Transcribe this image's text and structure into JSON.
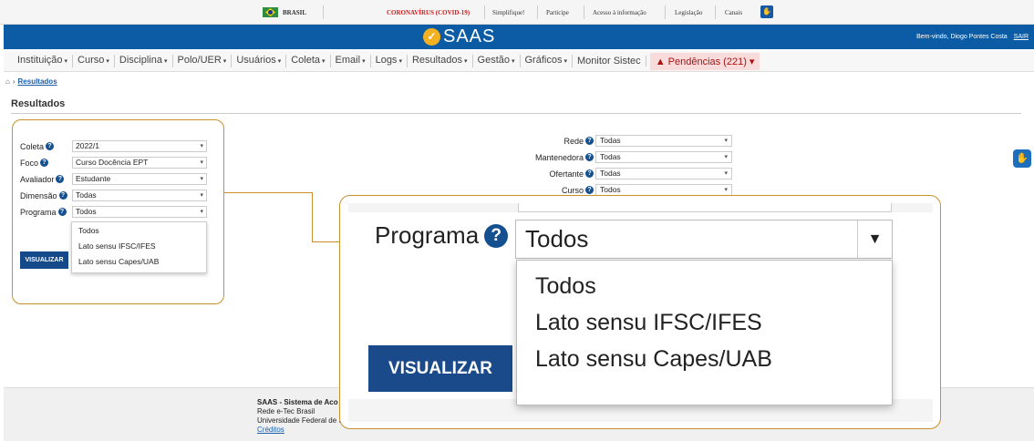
{
  "gov_bar": {
    "country": "BRASIL",
    "links": [
      "CORONAVÍRUS (COVID-19)",
      "Simplifique!",
      "Participe",
      "Acesso à informação",
      "Legislação",
      "Canais"
    ]
  },
  "header": {
    "app_name": "SAAS",
    "welcome": "Bem-vindo, Diogo Pontes Costa",
    "logout": "SAIR"
  },
  "menu": {
    "items": [
      "Instituição",
      "Curso",
      "Disciplina",
      "Polo/UER",
      "Usuários",
      "Coleta",
      "Email",
      "Logs",
      "Resultados",
      "Gestão",
      "Gráficos"
    ],
    "monitor": "Monitor Sistec",
    "pendencias": "Pendências (221)"
  },
  "breadcrumb": {
    "current": "Resultados"
  },
  "page": {
    "title": "Resultados"
  },
  "form_left": {
    "fields": [
      {
        "label": "Coleta",
        "value": "2022/1"
      },
      {
        "label": "Foco",
        "value": "Curso Docência EPT"
      },
      {
        "label": "Avaliador",
        "value": "Estudante"
      },
      {
        "label": "Dimensão",
        "value": "Todas"
      },
      {
        "label": "Programa",
        "value": "Todos"
      }
    ],
    "dropdown_options": [
      "Todos",
      "Lato sensu IFSC/IFES",
      "Lato sensu Capes/UAB"
    ],
    "submit_label": "VISUALIZAR"
  },
  "form_right": {
    "fields": [
      {
        "label": "Rede",
        "value": "Todas"
      },
      {
        "label": "Mantenedora",
        "value": "Todas"
      },
      {
        "label": "Ofertante",
        "value": "Todas"
      },
      {
        "label": "Curso",
        "value": "Todos"
      }
    ]
  },
  "zoom": {
    "label": "Programa",
    "value": "Todos",
    "options": [
      "Todos",
      "Lato sensu IFSC/IFES",
      "Lato sensu Capes/UAB"
    ],
    "submit_label": "VISUALIZAR"
  },
  "footer": {
    "title": "SAAS - Sistema de Aco",
    "line1": "Rede e-Tec Brasil",
    "line2": "Universidade Federal de S",
    "credits": "Créditos"
  },
  "colors": {
    "header_blue": "#0b5ca4",
    "accent_orange": "#c9902c",
    "button_blue": "#15498a"
  },
  "icons": [
    "brazil-flag-icon",
    "vlibras-icon",
    "saas-check-icon",
    "help-icon",
    "home-icon",
    "warning-icon",
    "caret-down-icon"
  ]
}
